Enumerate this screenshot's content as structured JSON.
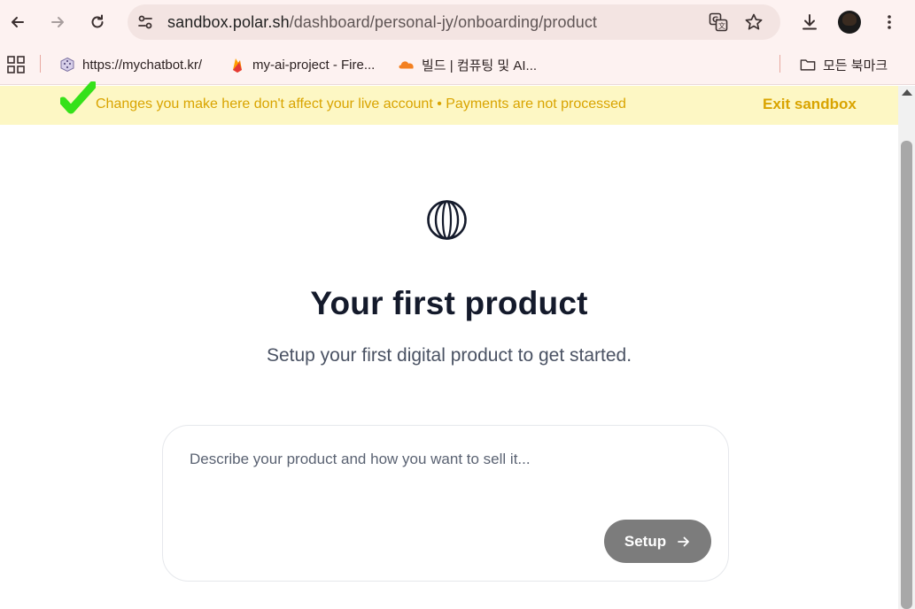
{
  "browser": {
    "omnibox": {
      "host": "sandbox.polar.sh",
      "path": "/dashboard/personal-jy/onboarding/product"
    },
    "bookmarks": [
      {
        "label": "https://mychatbot.kr/",
        "icon": "dice-icon"
      },
      {
        "label": "my-ai-project - Fire...",
        "icon": "firebase-icon"
      },
      {
        "label": "빌드 | 컴퓨팅 및 AI...",
        "icon": "cloudflare-icon"
      }
    ],
    "all_bookmarks_label": "모든 북마크"
  },
  "banner": {
    "message": "Changes you make here don't affect your live account • Payments are not processed",
    "exit_label": "Exit sandbox",
    "color": "#d9a400",
    "background": "#fdf7c4"
  },
  "main": {
    "title": "Your first product",
    "subtitle": "Setup your first digital product to get started.",
    "prompt": {
      "placeholder": "Describe your product and how you want to sell it...",
      "value": ""
    },
    "setup_label": "Setup"
  }
}
